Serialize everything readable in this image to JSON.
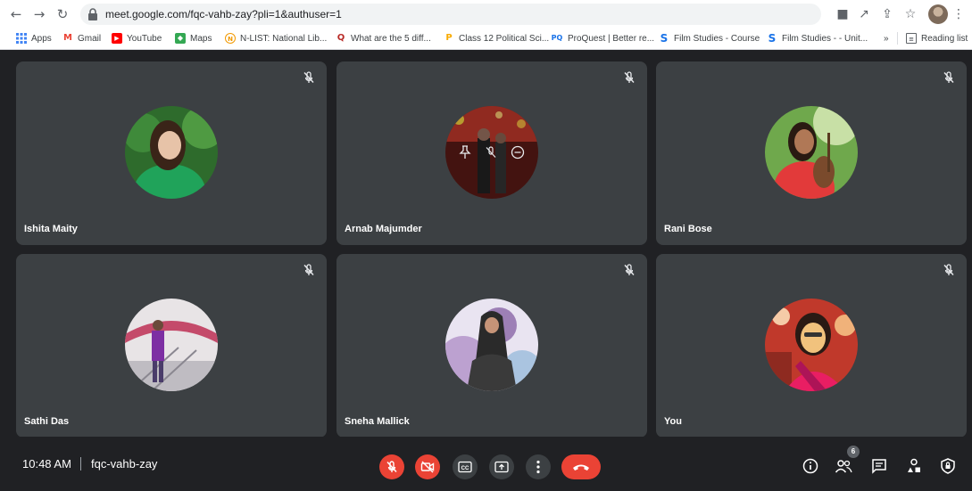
{
  "browser": {
    "url": "meet.google.com/fqc-vahb-zay?pli=1&authuser=1",
    "bookmarks": [
      {
        "label": "Apps",
        "icon": "apps-grid-icon",
        "color": "#4285f4"
      },
      {
        "label": "Gmail",
        "icon": "gmail-icon",
        "color": "#ea4335"
      },
      {
        "label": "YouTube",
        "icon": "youtube-icon",
        "color": "#ff0000"
      },
      {
        "label": "Maps",
        "icon": "maps-icon",
        "color": "#34a853"
      },
      {
        "label": "N-LIST: National Lib...",
        "icon": "nlist-icon",
        "color": "#f29900"
      },
      {
        "label": "What are the 5 diff...",
        "icon": "quora-icon",
        "color": "#b92b27"
      },
      {
        "label": "Class 12 Political Sci...",
        "icon": "class12-icon",
        "color": "#f9ab00"
      },
      {
        "label": "ProQuest | Better re...",
        "icon": "proquest-icon",
        "color": "#1a73e8"
      },
      {
        "label": "Film Studies - Course",
        "icon": "film-studies-icon",
        "color": "#1a73e8"
      },
      {
        "label": "Film Studies - - Unit...",
        "icon": "film-studies-unit-icon",
        "color": "#1a73e8"
      }
    ],
    "overflow_label": "»",
    "reading_list_label": "Reading list"
  },
  "meeting": {
    "time": "10:48 AM",
    "code": "fqc-vahb-zay",
    "people_count": "6",
    "participants": [
      {
        "name": "Ishita Maity",
        "muted": true,
        "avatar_colors": [
          "#2e6b2c",
          "#20a35a",
          "#e7c3a8",
          "#3a2418"
        ]
      },
      {
        "name": "Arnab Majumder",
        "muted": true,
        "avatar_colors": [
          "#5a1a16",
          "#c0392b",
          "#222222",
          "#9a7260"
        ]
      },
      {
        "name": "Rani Bose",
        "muted": true,
        "avatar_colors": [
          "#6fa84c",
          "#c8e0a6",
          "#e23a3a",
          "#7a4a2c"
        ]
      },
      {
        "name": "Sathi Das",
        "muted": true,
        "avatar_colors": [
          "#e8e4e6",
          "#c44a6a",
          "#7d2fa3",
          "#4a3c6a"
        ]
      },
      {
        "name": "Sneha Mallick",
        "muted": true,
        "avatar_colors": [
          "#e9e4f1",
          "#6b3c8f",
          "#2a2a2a",
          "#b090c8"
        ]
      },
      {
        "name": "You",
        "muted": true,
        "avatar_colors": [
          "#c0392b",
          "#e91e63",
          "#f1c27d",
          "#6a3a2a"
        ]
      }
    ]
  },
  "colors": {
    "meet_bg": "#202124",
    "tile_bg": "#3c4043",
    "danger": "#ea4335"
  }
}
